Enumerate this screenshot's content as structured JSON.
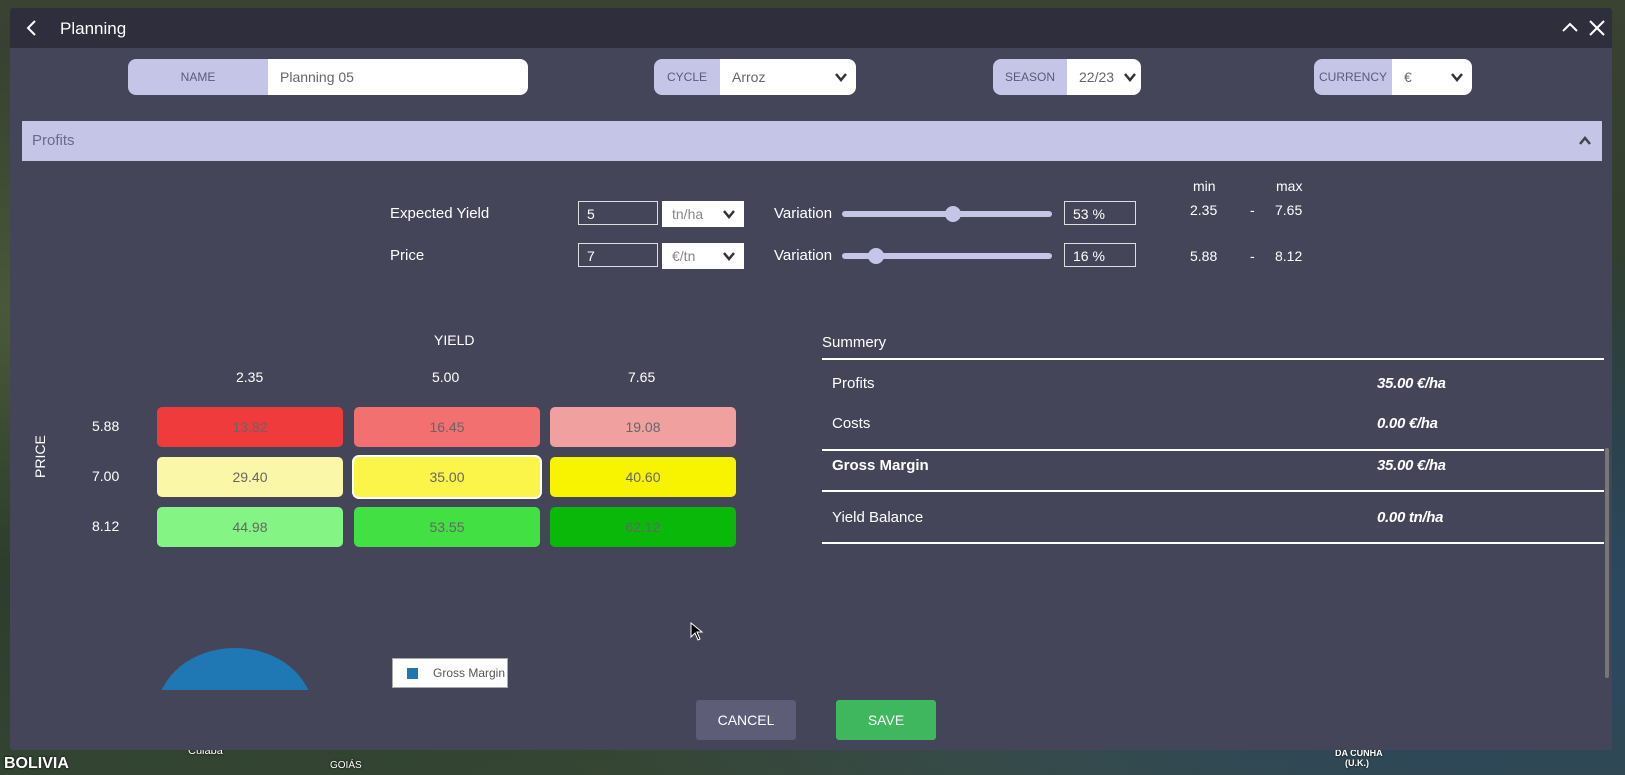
{
  "map": {
    "labels": [
      "BOLIVIA",
      "Cuiabá",
      "GOIÁS",
      "DA CUNHA",
      "(U.K.)"
    ]
  },
  "dialog": {
    "title": "Planning"
  },
  "form": {
    "name_label": "NAME",
    "name_value": "Planning 05",
    "cycle_label": "CYCLE",
    "cycle_value": "Arroz",
    "season_label": "SEASON",
    "season_value": "22/23",
    "currency_label": "CURRENCY",
    "currency_value": "€"
  },
  "profits": {
    "section_title": "Profits",
    "min_label": "min",
    "max_label": "max",
    "yield": {
      "label": "Expected Yield",
      "value": "5",
      "unit": "tn/ha",
      "variation_label": "Variation",
      "variation_value": "53 %",
      "variation_level": 0.53,
      "min": "2.35",
      "dash": "-",
      "max": "7.65"
    },
    "price": {
      "label": "Price",
      "value": "7",
      "unit": "€/tn",
      "variation_label": "Variation",
      "variation_value": "16 %",
      "variation_level": 0.16,
      "min": "5.88",
      "dash": "-",
      "max": "8.12"
    }
  },
  "matrix": {
    "yield_title": "YIELD",
    "price_title": "PRICE",
    "yield_headers": [
      "2.35",
      "5.00",
      "7.65"
    ],
    "price_headers": [
      "5.88",
      "7.00",
      "8.12"
    ],
    "cells": [
      [
        "13.82",
        "16.45",
        "19.08"
      ],
      [
        "29.40",
        "35.00",
        "40.60"
      ],
      [
        "44.98",
        "53.55",
        "62.12"
      ]
    ],
    "colors": [
      [
        "#ef3b3b",
        "#f27070",
        "#f1a0a0"
      ],
      [
        "#fbf7a8",
        "#fbf54a",
        "#f8f400"
      ],
      [
        "#84f584",
        "#43e043",
        "#0ab80a"
      ]
    ]
  },
  "summary": {
    "title": "Summery",
    "profits_label": "Profits",
    "profits_value": "35.00 €/ha",
    "costs_label": "Costs",
    "costs_value": "0.00 €/ha",
    "gross_margin_label": "Gross Margin",
    "gross_margin_value": "35.00 €/ha",
    "yield_balance_label": "Yield Balance",
    "yield_balance_value": "0.00 tn/ha"
  },
  "chart": {
    "legend_label": "Gross Margin",
    "color": "#1f77b4"
  },
  "actions": {
    "cancel_label": "CANCEL",
    "save_label": "SAVE"
  }
}
